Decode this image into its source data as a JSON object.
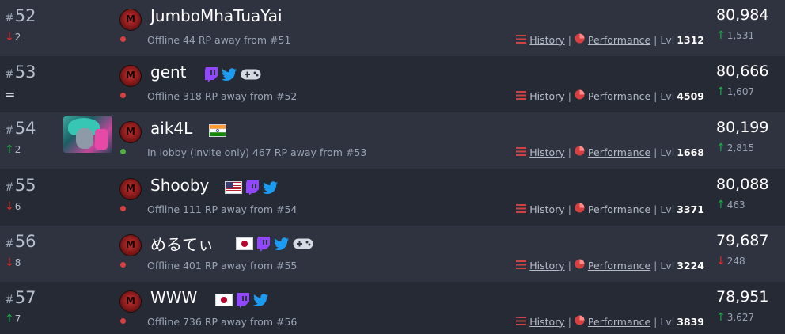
{
  "colors": {
    "row_even": "#2f3340",
    "row_odd": "#262a35",
    "up": "#20a94a",
    "down": "#e02b2b",
    "online": "#52b043",
    "offline": "#d64040",
    "twitch": "#9146ff",
    "twitter": "#1d9bf0"
  },
  "labels": {
    "history": "History",
    "performance": "Performance",
    "lvl": "Lvl"
  },
  "rows": [
    {
      "rank": "52",
      "rank_change": "2",
      "rank_dir": "down",
      "name": "JumboMhaTuaYai",
      "status": "Offline 44 RP away from #51",
      "online": false,
      "level": "1312",
      "rp": "80,984",
      "rp_change": "1,531",
      "rp_dir": "up",
      "icons": []
    },
    {
      "rank": "53",
      "rank_change": "=",
      "rank_dir": "same",
      "name": "gent",
      "status": "Offline 318 RP away from #52",
      "online": false,
      "level": "4509",
      "rp": "80,666",
      "rp_change": "1,607",
      "rp_dir": "up",
      "icons": [
        "twitch-icon",
        "twitter-icon",
        "gamepad-icon"
      ]
    },
    {
      "rank": "54",
      "rank_change": "2",
      "rank_dir": "up",
      "name": "aik4L",
      "status": "In lobby (invite only) 467 RP away from #53",
      "online": true,
      "level": "1668",
      "rp": "80,199",
      "rp_change": "2,815",
      "rp_dir": "up",
      "icons": [
        "india-flag-icon"
      ],
      "avatar": "anime-avatar"
    },
    {
      "rank": "55",
      "rank_change": "6",
      "rank_dir": "down",
      "name": "Shooby",
      "status": "Offline 111 RP away from #54",
      "online": false,
      "level": "3371",
      "rp": "80,088",
      "rp_change": "463",
      "rp_dir": "up",
      "icons": [
        "usa-flag-icon",
        "twitch-icon",
        "twitter-icon"
      ]
    },
    {
      "rank": "56",
      "rank_change": "8",
      "rank_dir": "down",
      "name": "めるてぃ",
      "status": "Offline 401 RP away from #55",
      "online": false,
      "level": "3224",
      "rp": "79,687",
      "rp_change": "248",
      "rp_dir": "down",
      "icons": [
        "japan-flag-icon",
        "twitch-icon",
        "twitter-icon",
        "gamepad-icon"
      ]
    },
    {
      "rank": "57",
      "rank_change": "7",
      "rank_dir": "up",
      "name": "WWW",
      "status": "Offline 736 RP away from #56",
      "online": false,
      "level": "3839",
      "rp": "78,951",
      "rp_change": "3,627",
      "rp_dir": "up",
      "icons": [
        "japan-flag-icon",
        "twitch-icon",
        "twitter-icon"
      ]
    }
  ]
}
